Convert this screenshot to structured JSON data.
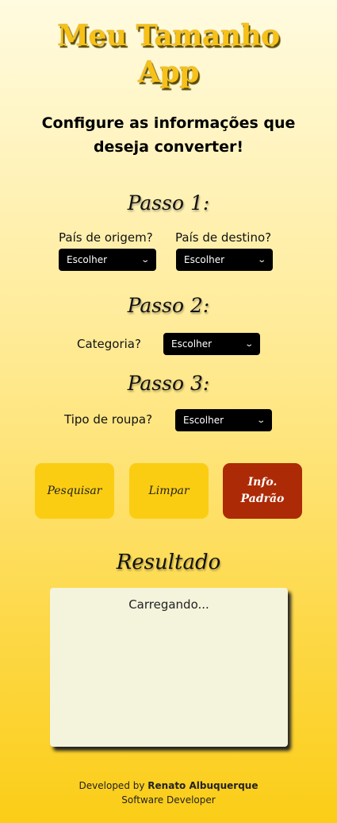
{
  "header": {
    "title_line1": "Meu Tamanho",
    "title_line2": "App",
    "subtitle": "Configure as informações que deseja converter!"
  },
  "step1": {
    "title": "Passo 1:",
    "origin_label": "País de origem?",
    "origin_value": "Escolher",
    "destination_label": "País de destino?",
    "destination_value": "Escolher"
  },
  "step2": {
    "title": "Passo 2:",
    "category_label": "Categoria?",
    "category_value": "Escolher"
  },
  "step3": {
    "title": "Passo 3:",
    "clothing_label": "Tipo de roupa?",
    "clothing_value": "Escolher"
  },
  "buttons": {
    "search": "Pesquisar",
    "clear": "Limpar",
    "info_line1": "Info.",
    "info_line2": "Padrão"
  },
  "result": {
    "title": "Resultado",
    "status": "Carregando..."
  },
  "footer": {
    "developed_by": "Developed by",
    "author": "Renato Albuquerque",
    "role": "Software Developer"
  },
  "colors": {
    "title_yellow": "#f7c117",
    "button_yellow": "#fbcd12",
    "button_red": "#ad2a06",
    "select_bg": "#000000",
    "result_bg": "#f4f3dc"
  },
  "icons": {
    "select_arrow": "chevron-down-icon"
  }
}
